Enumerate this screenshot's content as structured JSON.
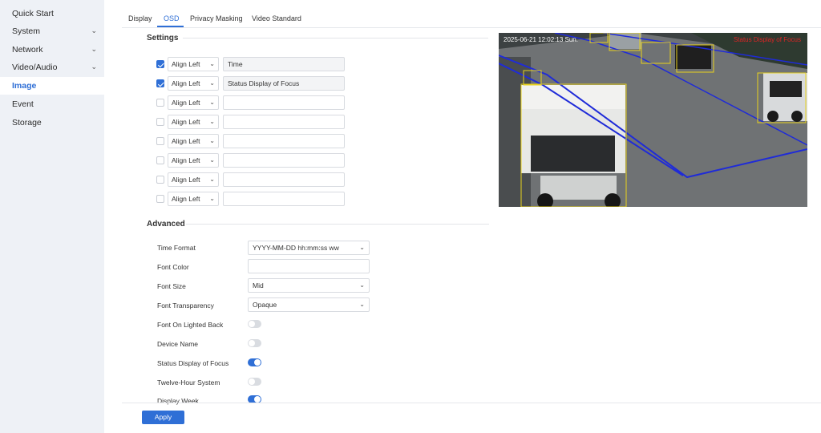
{
  "sidebar": {
    "items": [
      {
        "label": "Quick Start",
        "chevron": false
      },
      {
        "label": "System",
        "chevron": true
      },
      {
        "label": "Network",
        "chevron": true
      },
      {
        "label": "Video/Audio",
        "chevron": true
      },
      {
        "label": "Image",
        "chevron": false,
        "active": true
      },
      {
        "label": "Event",
        "chevron": false
      },
      {
        "label": "Storage",
        "chevron": false
      }
    ]
  },
  "tabs": [
    {
      "label": "Display"
    },
    {
      "label": "OSD",
      "active": true
    },
    {
      "label": "Privacy Masking"
    },
    {
      "label": "Video Standard"
    }
  ],
  "settings": {
    "title": "Settings",
    "rows": [
      {
        "checked": true,
        "align": "Align Left",
        "text": "Time"
      },
      {
        "checked": true,
        "align": "Align Left",
        "text": "Status Display of Focus"
      },
      {
        "checked": false,
        "align": "Align Left",
        "text": ""
      },
      {
        "checked": false,
        "align": "Align Left",
        "text": ""
      },
      {
        "checked": false,
        "align": "Align Left",
        "text": ""
      },
      {
        "checked": false,
        "align": "Align Left",
        "text": ""
      },
      {
        "checked": false,
        "align": "Align Left",
        "text": ""
      },
      {
        "checked": false,
        "align": "Align Left",
        "text": ""
      }
    ]
  },
  "advanced": {
    "title": "Advanced",
    "time_format": {
      "label": "Time Format",
      "value": "YYYY-MM-DD hh:mm:ss ww"
    },
    "font_color": {
      "label": "Font Color",
      "value": ""
    },
    "font_size": {
      "label": "Font Size",
      "value": "Mid"
    },
    "font_transparency": {
      "label": "Font Transparency",
      "value": "Opaque"
    },
    "toggles": [
      {
        "label": "Font On Lighted Back",
        "on": false
      },
      {
        "label": "Device Name",
        "on": false
      },
      {
        "label": "Status Display of Focus",
        "on": true
      },
      {
        "label": "Twelve-Hour System",
        "on": false
      },
      {
        "label": "Display Week",
        "on": true
      }
    ]
  },
  "preview": {
    "osd_time": "2025-06-21 12:02:13 Sun.",
    "osd_focus": "Status Display of Focus"
  },
  "footer": {
    "apply_label": "Apply"
  },
  "colors": {
    "accent": "#2f6fd6",
    "sidebar_bg": "#eef1f6",
    "osd_focus_text": "#e02424",
    "detection_box": "#e8d21c",
    "rule_line": "#1f2bd8"
  }
}
